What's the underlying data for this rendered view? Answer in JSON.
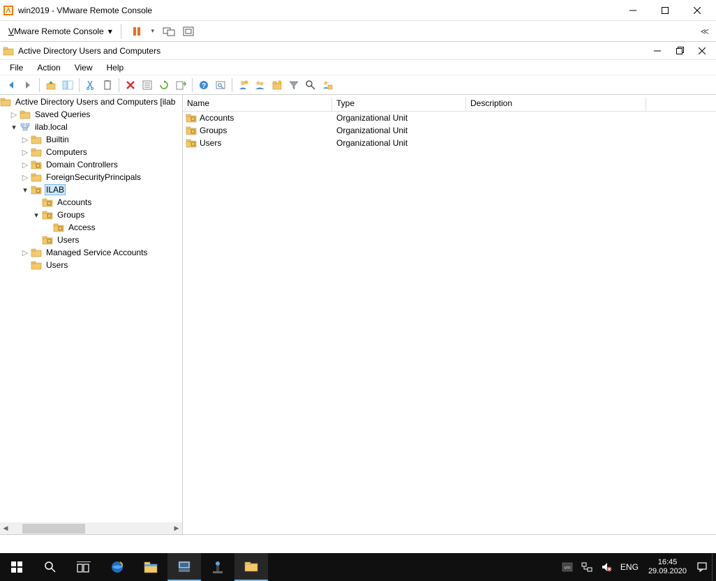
{
  "vmrc": {
    "title": "win2019 - VMware Remote Console",
    "menu_label": "VMware Remote Console"
  },
  "aduc": {
    "title": "Active Directory Users and Computers",
    "menu": {
      "file": "File",
      "action": "Action",
      "view": "View",
      "help": "Help"
    },
    "tree_root": "Active Directory Users and Computers [ilab",
    "tree": {
      "saved_queries": "Saved Queries",
      "domain": "ilab.local",
      "builtin": "Builtin",
      "computers": "Computers",
      "domain_controllers": "Domain Controllers",
      "fsp": "ForeignSecurityPrincipals",
      "ilab": "ILAB",
      "ilab_accounts": "Accounts",
      "ilab_groups": "Groups",
      "ilab_access": "Access",
      "ilab_users": "Users",
      "msa": "Managed Service Accounts",
      "users": "Users"
    },
    "list_header": {
      "name": "Name",
      "type": "Type",
      "description": "Description"
    },
    "list_rows": [
      {
        "name": "Accounts",
        "type": "Organizational Unit",
        "desc": ""
      },
      {
        "name": "Groups",
        "type": "Organizational Unit",
        "desc": ""
      },
      {
        "name": "Users",
        "type": "Organizational Unit",
        "desc": ""
      }
    ]
  },
  "taskbar": {
    "lang": "ENG",
    "time": "16:45",
    "date": "29.09.2020"
  }
}
